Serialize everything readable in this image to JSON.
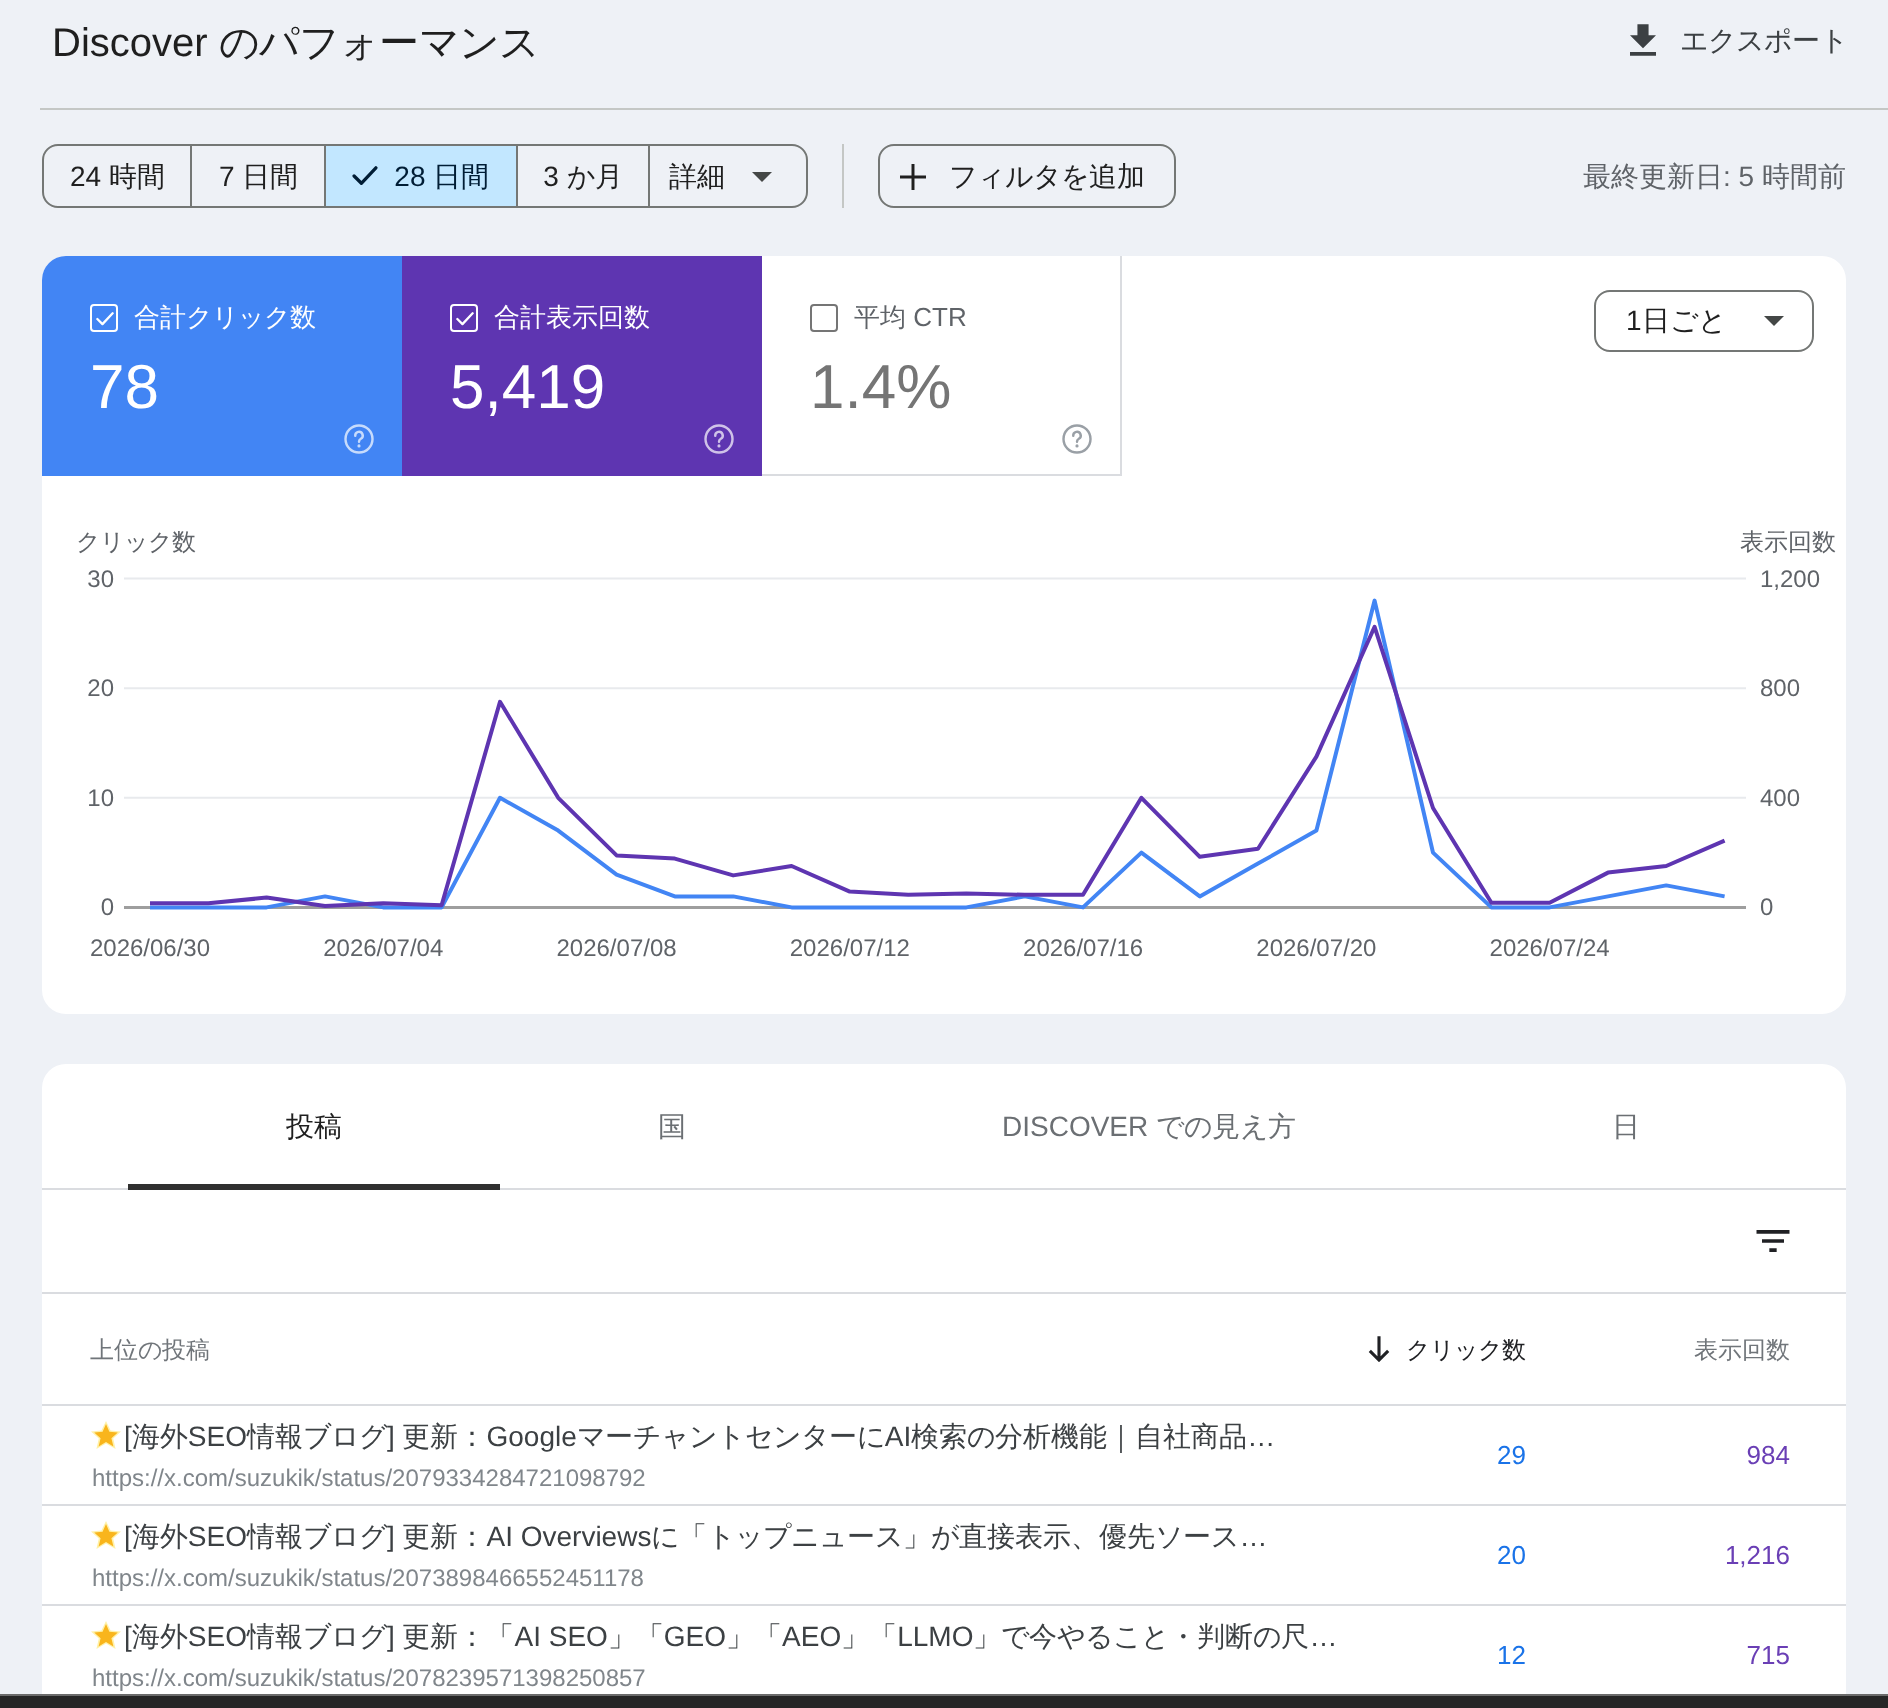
{
  "header": {
    "title": "Discover のパフォーマンス",
    "export_label": "エクスポート"
  },
  "filters": {
    "ranges": [
      {
        "label": "24 時間",
        "selected": false
      },
      {
        "label": "7 日間",
        "selected": false
      },
      {
        "label": "28 日間",
        "selected": true
      },
      {
        "label": "3 か月",
        "selected": false
      }
    ],
    "more_label": "詳細",
    "add_filter_label": "フィルタを追加",
    "last_updated": "最終更新日: 5 時間前"
  },
  "metrics": [
    {
      "label": "合計クリック数",
      "value": "78",
      "checked": true,
      "color": "#4285f4"
    },
    {
      "label": "合計表示回数",
      "value": "5,419",
      "checked": true,
      "color": "#5e35b1"
    },
    {
      "label": "平均 CTR",
      "value": "1.4%",
      "checked": false
    }
  ],
  "granularity": "1日ごと",
  "chart_data": {
    "type": "line",
    "ylabel": "クリック数",
    "y2label": "表示回数",
    "categories": [
      "2026/06/30",
      null,
      null,
      null,
      "2026/07/04",
      null,
      null,
      null,
      "2026/07/08",
      null,
      null,
      null,
      "2026/07/12",
      null,
      null,
      null,
      "2026/07/16",
      null,
      null,
      null,
      "2026/07/20",
      null,
      null,
      null,
      "2026/07/24",
      null,
      null,
      null
    ],
    "series": [
      {
        "color": "#4285f4",
        "values": [
          0,
          0,
          0,
          1,
          0,
          0,
          10,
          7,
          3,
          1,
          1,
          0,
          0,
          0,
          0,
          1,
          0,
          5,
          1,
          4,
          7,
          28,
          5,
          0,
          0,
          1,
          2,
          1
        ]
      },
      {
        "color": "#5e35b1",
        "axis": "y2",
        "values": [
          15,
          15,
          36,
          5,
          15,
          8,
          750,
          400,
          190,
          178,
          117,
          151,
          58,
          46,
          51,
          46,
          46,
          400,
          185,
          214,
          550,
          1024,
          363,
          17,
          17,
          127,
          151,
          244
        ]
      }
    ],
    "ylim": [
      0,
      30
    ],
    "y2lim": [
      0,
      1200
    ],
    "yticks": [
      0,
      10,
      20,
      30
    ],
    "y2ticks": [
      0,
      400,
      800,
      {
        "value": 1200,
        "label": "1,200"
      }
    ]
  },
  "tabs": [
    {
      "label": "投稿",
      "selected": true
    },
    {
      "label": "国",
      "selected": false
    },
    {
      "label": "DISCOVER での見え方",
      "selected": false
    },
    {
      "label": "日",
      "selected": false
    }
  ],
  "table": {
    "columns": [
      {
        "label": "上位の投稿",
        "sorted": false
      },
      {
        "label": "クリック数",
        "sorted": true
      },
      {
        "label": "表示回数",
        "sorted": false
      }
    ],
    "rows": [
      {
        "title": "[海外SEO情報ブログ] 更新：GoogleマーチャントセンターにAI検索の分析機能｜自社商品…",
        "url": "https://x.com/suzukik/status/2079334284721098792",
        "clicks": "29",
        "impressions": "984"
      },
      {
        "title": "[海外SEO情報ブログ] 更新：AI Overviewsに「トップニュース」が直接表示、優先ソース…",
        "url": "https://x.com/suzukik/status/2073898466552451178",
        "clicks": "20",
        "impressions": "1,216"
      },
      {
        "title": "[海外SEO情報ブログ] 更新：「AI SEO」「GEO」「AEO」「LLMO」で今やること・判断の尺…",
        "url": "https://x.com/suzukik/status/2078239571398250857",
        "clicks": "12",
        "impressions": "715"
      }
    ]
  }
}
